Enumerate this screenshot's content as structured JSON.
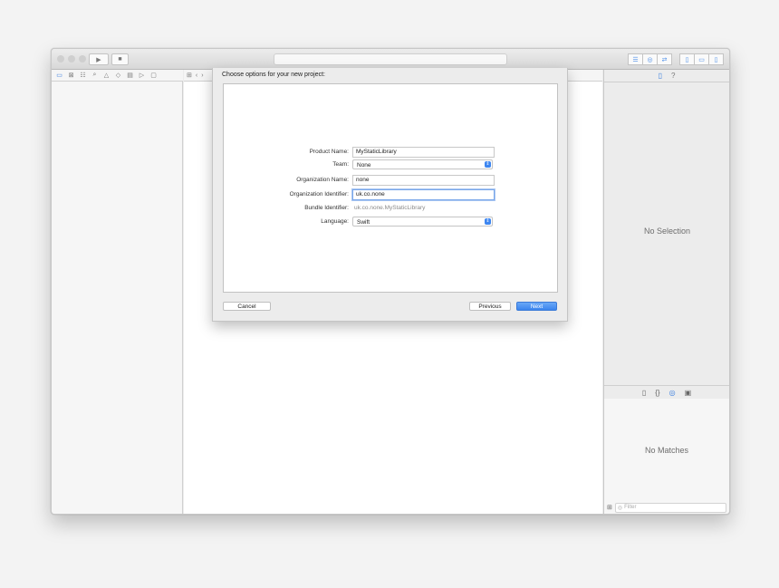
{
  "toolbar": {
    "run_icon": "play-icon",
    "stop_icon": "stop-icon",
    "traffic_colors": [
      "#cfcfcf",
      "#cfcfcf",
      "#cfcfcf"
    ]
  },
  "inspector": {
    "no_selection": "No Selection",
    "no_matches": "No Matches",
    "filter_placeholder": "Filter"
  },
  "sheet": {
    "title": "Choose options for your new project:",
    "fields": {
      "product_name": {
        "label": "Product Name:",
        "value": "MyStaticLibrary"
      },
      "team": {
        "label": "Team:",
        "value": "None"
      },
      "organization_name": {
        "label": "Organization Name:",
        "value": "none"
      },
      "organization_identifier": {
        "label": "Organization Identifier:",
        "value": "uk.co.none"
      },
      "bundle_identifier": {
        "label": "Bundle Identifier:",
        "value": "uk.co.none.MyStaticLibrary"
      },
      "language": {
        "label": "Language:",
        "value": "Swift"
      }
    },
    "buttons": {
      "cancel": "Cancel",
      "previous": "Previous",
      "next": "Next"
    }
  },
  "colors": {
    "accent": "#3b85ee"
  }
}
